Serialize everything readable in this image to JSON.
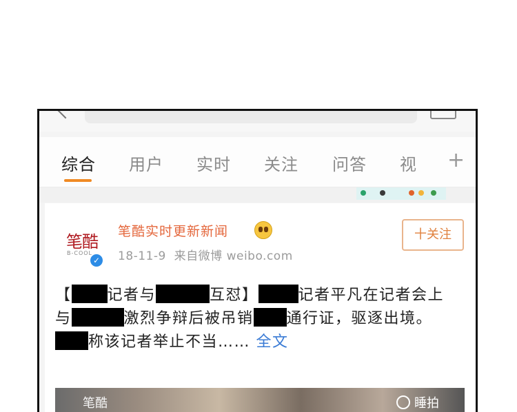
{
  "tabs": [
    {
      "label": "综合",
      "active": true
    },
    {
      "label": "用户",
      "active": false
    },
    {
      "label": "实时",
      "active": false
    },
    {
      "label": "关注",
      "active": false
    },
    {
      "label": "问答",
      "active": false
    },
    {
      "label": "视",
      "active": false
    }
  ],
  "tab_add_label": "+",
  "post": {
    "avatar_text": "笔酷",
    "avatar_subtext": "B-COOL",
    "verified_mark": "✓",
    "username": "笔酷实时更新新闻",
    "date": "18-11-9",
    "source": "来自微博 weibo.com",
    "follow_label": "十关注",
    "text_parts": [
      "【",
      "记者与",
      "互怼】",
      "记者平凡在记者会上与",
      "激烈争辩后被吊销",
      "通行证，驱逐出境。",
      "称该记者举止不当……"
    ],
    "full_text_label": "全文",
    "media_source": "笔酷",
    "media_badge": "睡拍"
  },
  "colors": {
    "accent": "#f08a24",
    "username": "#e4673c",
    "link": "#3a7bd5",
    "verified": "#2d8ce6"
  }
}
